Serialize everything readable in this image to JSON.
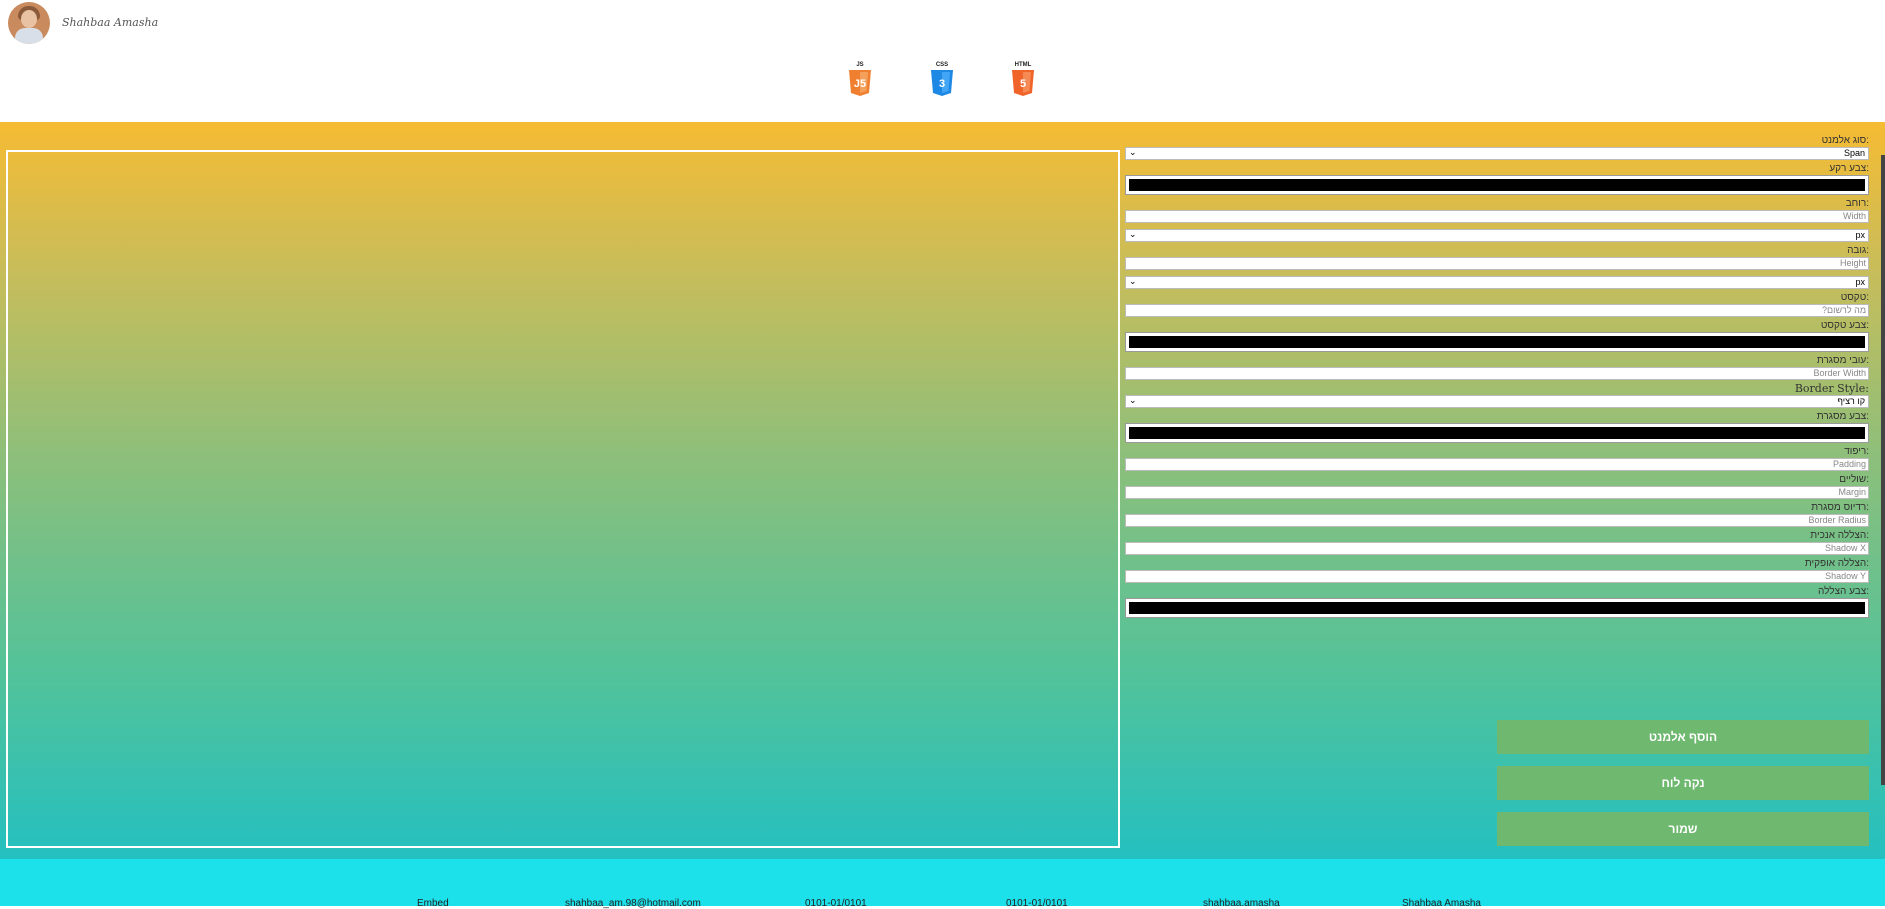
{
  "header": {
    "signature": "Shahbaa Amasha",
    "tech_icons": [
      {
        "name": "JS",
        "color": "#f08030"
      },
      {
        "name": "CSS",
        "color": "#1e88e5"
      },
      {
        "name": "HTML",
        "color": "#f0642a"
      }
    ]
  },
  "form": {
    "element_type_label": "סוג אלמנט:",
    "element_type_value": "Span",
    "bg_color_label": "צבע רקע:",
    "width_label": "רוחב:",
    "width_placeholder": "Width",
    "width_unit": "px",
    "height_label": "גובה:",
    "height_placeholder": "Height",
    "height_unit": "px",
    "text_label": "טקסט:",
    "text_placeholder": "מה לרשום?",
    "text_color_label": "צבע טקסט:",
    "border_width_label": "עובי מסגרת:",
    "border_width_placeholder": "Border Width",
    "border_style_label": "Border Style:",
    "border_style_value": "קו רציף",
    "border_color_label": "צבע מסגרת:",
    "padding_label": "ריפוד:",
    "padding_placeholder": "Padding",
    "margin_label": "שוליים:",
    "margin_placeholder": "Margin",
    "border_radius_label": "רדיוס מסגרת:",
    "border_radius_placeholder": "Border Radius",
    "shadow_x_label": "הצללה אנכית:",
    "shadow_x_placeholder": "Shadow X",
    "shadow_y_label": "הצללה אופקית:",
    "shadow_y_placeholder": "Shadow Y",
    "shadow_color_label": "צבע הצללה:"
  },
  "buttons": {
    "add_element": "הוסף אלמנט",
    "clear_board": "נקה לוח",
    "save": "שמור"
  },
  "footer": {
    "items": [
      "Shahbaa Amasha",
      "shahbaa.amasha",
      "0101-01/0101",
      "0101-01/0101",
      "shahbaa_am.98@hotmail.com",
      "Embed"
    ]
  },
  "colors": {
    "accent_button": "#6fb870",
    "footer_bg": "#1ce0ea",
    "gradient_top": "#f6bb33",
    "gradient_bottom": "#24c0c0"
  }
}
